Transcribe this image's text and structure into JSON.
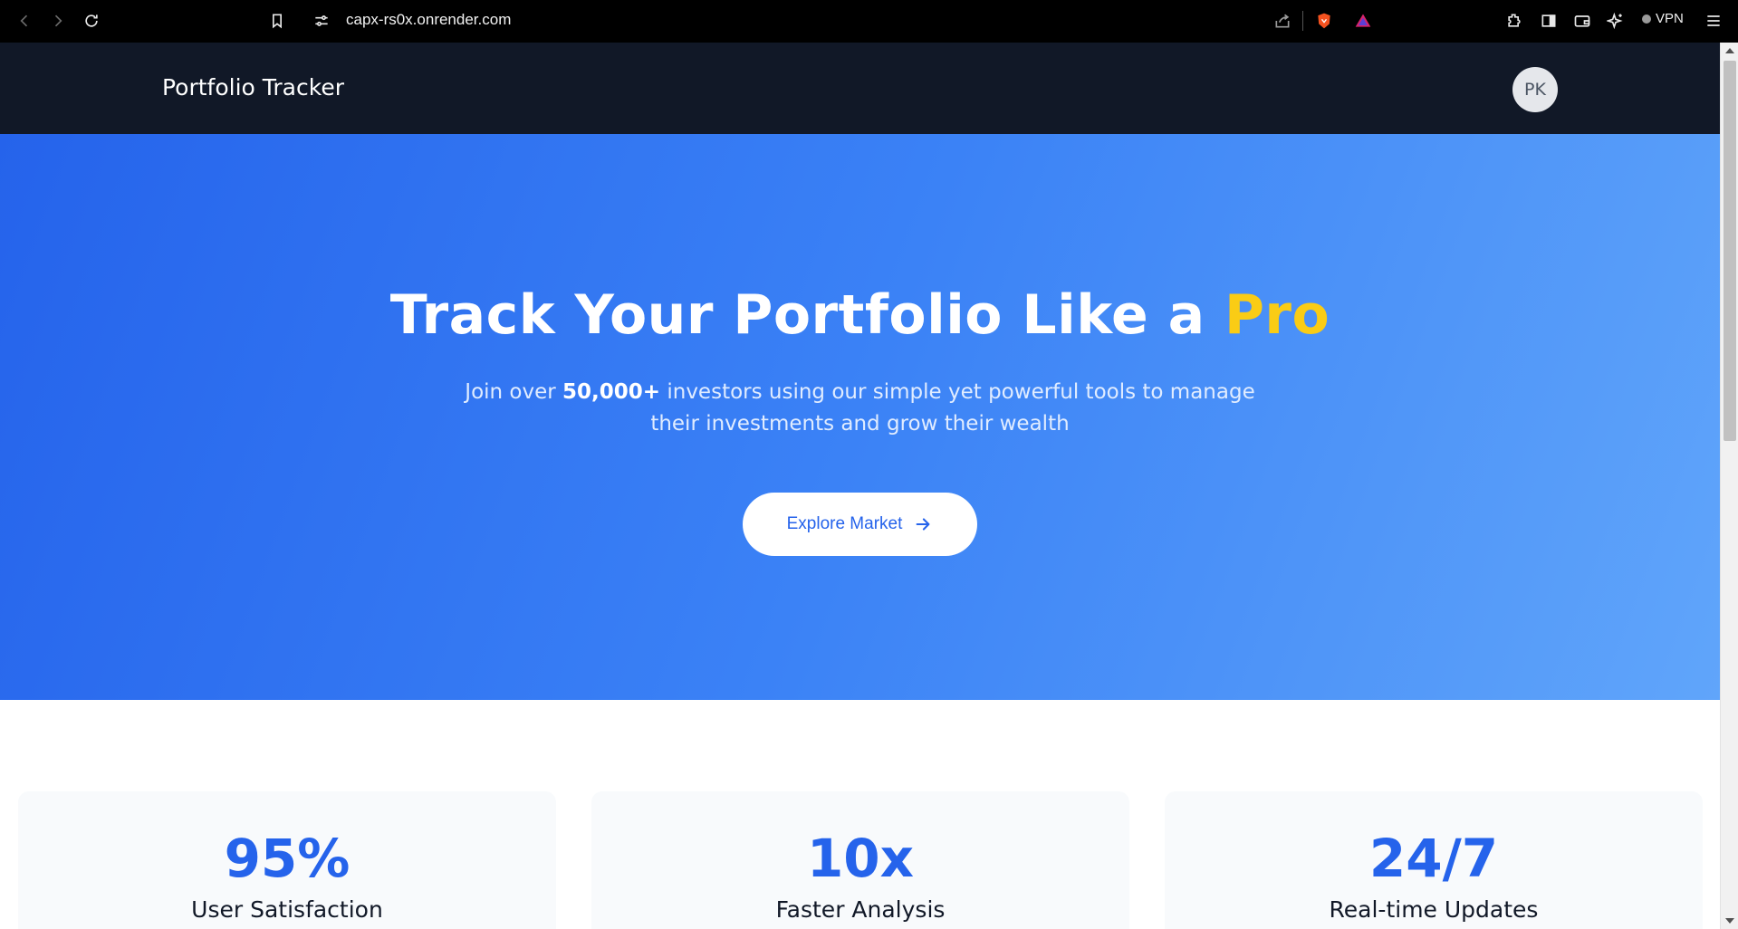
{
  "browser": {
    "url": "capx-rs0x.onrender.com",
    "vpn_label": "VPN"
  },
  "navbar": {
    "brand": "Portfolio Tracker",
    "avatar_initials": "PK"
  },
  "hero": {
    "title_main": "Track Your Portfolio Like a ",
    "title_accent": "Pro",
    "accent_color": "#facc15",
    "subtitle_before": "Join over ",
    "subtitle_bold": "50,000+",
    "subtitle_after": " investors using our simple yet powerful tools to manage their investments and grow their wealth",
    "cta_label": "Explore Market"
  },
  "stats": [
    {
      "value": "95%",
      "label": "User Satisfaction"
    },
    {
      "value": "10x",
      "label": "Faster Analysis"
    },
    {
      "value": "24/7",
      "label": "Real-time Updates"
    }
  ],
  "colors": {
    "brand_blue": "#2563eb",
    "navbar_bg": "#111827"
  }
}
